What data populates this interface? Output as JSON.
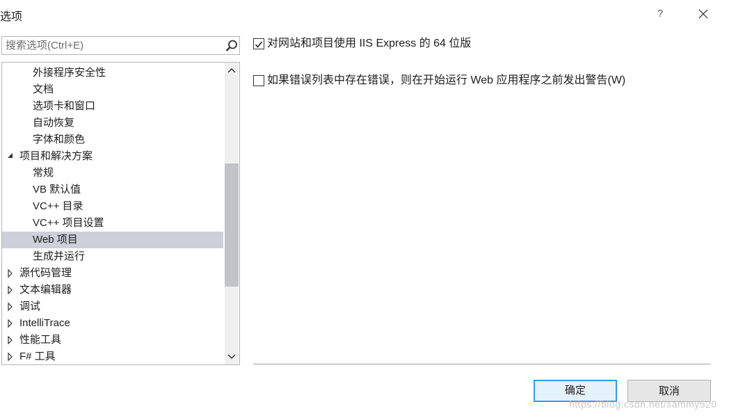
{
  "window": {
    "title": "选项",
    "help_label": "?"
  },
  "search": {
    "placeholder": "搜索选项(Ctrl+E)"
  },
  "tree": {
    "items": [
      {
        "label": "外接程序安全性",
        "level": 1,
        "expander": "none",
        "selected": false
      },
      {
        "label": "文档",
        "level": 1,
        "expander": "none",
        "selected": false
      },
      {
        "label": "选项卡和窗口",
        "level": 1,
        "expander": "none",
        "selected": false
      },
      {
        "label": "自动恢复",
        "level": 1,
        "expander": "none",
        "selected": false
      },
      {
        "label": "字体和颜色",
        "level": 1,
        "expander": "none",
        "selected": false
      },
      {
        "label": "项目和解决方案",
        "level": 0,
        "expander": "expanded",
        "selected": false
      },
      {
        "label": "常规",
        "level": 1,
        "expander": "none",
        "selected": false
      },
      {
        "label": "VB 默认值",
        "level": 1,
        "expander": "none",
        "selected": false
      },
      {
        "label": "VC++ 目录",
        "level": 1,
        "expander": "none",
        "selected": false
      },
      {
        "label": "VC++ 项目设置",
        "level": 1,
        "expander": "none",
        "selected": false
      },
      {
        "label": "Web 项目",
        "level": 1,
        "expander": "none",
        "selected": true
      },
      {
        "label": "生成并运行",
        "level": 1,
        "expander": "none",
        "selected": false
      },
      {
        "label": "源代码管理",
        "level": 0,
        "expander": "collapsed",
        "selected": false
      },
      {
        "label": "文本编辑器",
        "level": 0,
        "expander": "collapsed",
        "selected": false
      },
      {
        "label": "调试",
        "level": 0,
        "expander": "collapsed",
        "selected": false
      },
      {
        "label": "IntelliTrace",
        "level": 0,
        "expander": "collapsed",
        "selected": false
      },
      {
        "label": "性能工具",
        "level": 0,
        "expander": "collapsed",
        "selected": false
      },
      {
        "label": "F# 工具",
        "level": 0,
        "expander": "collapsed",
        "selected": false
      }
    ]
  },
  "options": [
    {
      "label": "对网站和项目使用 IIS Express 的 64 位版",
      "checked": true
    },
    {
      "label": "如果错误列表中存在错误，则在开始运行 Web 应用程序之前发出警告(W)",
      "checked": false
    }
  ],
  "buttons": {
    "ok_label": "确定",
    "cancel_label": "取消"
  },
  "watermark": "https://blog.csdn.net/sammy520",
  "colors": {
    "selected_row": "#cdcfd9",
    "ok_border": "#3399ff",
    "scroll_thumb": "#c2c3c9"
  },
  "icons": {
    "search": "search-icon",
    "close": "close-icon",
    "expanded": "triangle-down-icon",
    "collapsed": "triangle-right-icon",
    "check": "checkmark-icon"
  }
}
